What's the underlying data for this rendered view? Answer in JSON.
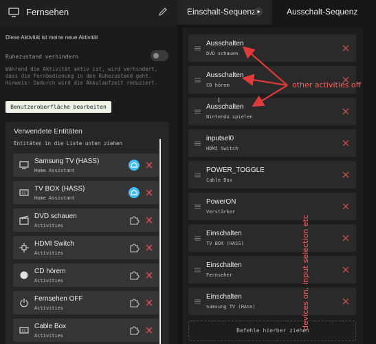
{
  "left": {
    "title": "Fernsehen",
    "favorite_text": "Diese Aktivität ist meine neue Aktivität",
    "sleep_label": "Ruhezustand verhindern",
    "sleep_desc": "Während die Aktivität aktiv ist, wird verhindert, dass die Fernbedienung in den Ruhezustand geht. Hinweis: Dadurch wird die Akkulaufzeit reduziert.",
    "edit_ui_button": "Benutzeroberfläche bearbeiten",
    "entities_title": "Verwendete Entitäten",
    "entities_sub": "Entitäten in die Liste unten ziehen",
    "entities": [
      {
        "name": "Samsung TV (HASS)",
        "sub": "Home Assistant",
        "icon": "tv-icon",
        "action": "home-assistant-icon"
      },
      {
        "name": "TV BOX (HASS)",
        "sub": "Home Assistant",
        "icon": "cc-box-icon",
        "action": "home-assistant-icon"
      },
      {
        "name": "DVD schauen",
        "sub": "Activities",
        "icon": "clapperboard-icon",
        "action": "puzzle-icon"
      },
      {
        "name": "HDMI Switch",
        "sub": "Activities",
        "icon": "switch-icon",
        "action": "puzzle-icon"
      },
      {
        "name": "CD hörem",
        "sub": "Activities",
        "icon": "circle-icon",
        "action": "puzzle-icon"
      },
      {
        "name": "Fernsehen OFF",
        "sub": "Activities",
        "icon": "power-icon",
        "action": "puzzle-icon"
      },
      {
        "name": "Cable Box",
        "sub": "Activities",
        "icon": "cc-box-icon",
        "action": "puzzle-icon"
      }
    ]
  },
  "tabs": {
    "on_label": "Einschalt-Sequenz",
    "off_label": "Ausschalt-Sequenz"
  },
  "sequence": [
    {
      "title": "Ausschalten",
      "sub": "DVD schauen"
    },
    {
      "title": "Ausschalten",
      "sub": "CD hörem"
    },
    {
      "title": "Ausschalten",
      "sub": "Nintendo spielen"
    },
    {
      "title": "inputsel0",
      "sub": "HDMI Switch"
    },
    {
      "title": "POWER_TOGGLE",
      "sub": "Cable Box"
    },
    {
      "title": "PowerON",
      "sub": "Verstärker"
    },
    {
      "title": "Einschalten",
      "sub": "TV BOX (HASS)"
    },
    {
      "title": "Einschalten",
      "sub": "Fernseher"
    },
    {
      "title": "Einschalten",
      "sub": "Samsung TV (HASS)"
    }
  ],
  "drop_zone": "Befehle hierher ziehen",
  "annotations": {
    "other_activities": "other activities off",
    "devices_on": "devices on, input selection etc"
  },
  "colors": {
    "accent_ha": "#41bdf5",
    "delete_red": "#e05555",
    "annotation_red": "#ff5c5c"
  }
}
